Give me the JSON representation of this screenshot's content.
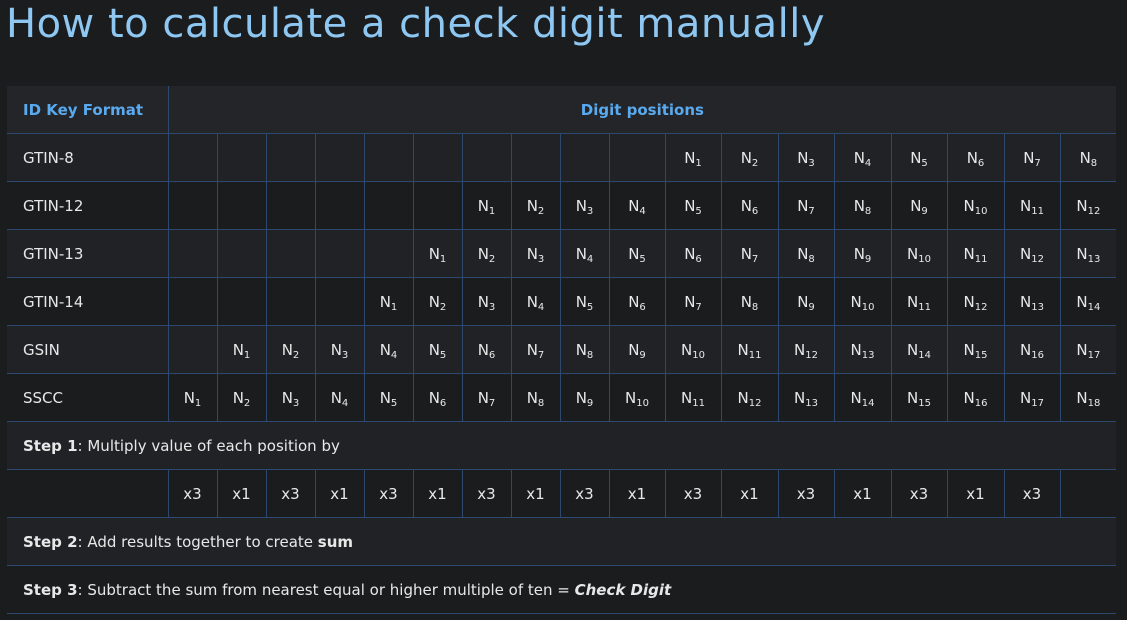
{
  "title": "How to calculate a check digit manually",
  "header": {
    "col0": "ID Key Format",
    "col1": "Digit positions"
  },
  "rows": [
    {
      "label": "GTIN-8",
      "start": 10,
      "count": 8
    },
    {
      "label": "GTIN-12",
      "start": 6,
      "count": 12
    },
    {
      "label": "GTIN-13",
      "start": 5,
      "count": 13
    },
    {
      "label": "GTIN-14",
      "start": 4,
      "count": 14
    },
    {
      "label": "GSIN",
      "start": 1,
      "count": 17
    },
    {
      "label": "SSCC",
      "start": 0,
      "count": 18
    }
  ],
  "digit_prefix": "N",
  "multipliers": [
    "x3",
    "x1",
    "x3",
    "x1",
    "x3",
    "x1",
    "x3",
    "x1",
    "x3",
    "x1",
    "x3",
    "x1",
    "x3",
    "x1",
    "x3",
    "x1",
    "x3",
    ""
  ],
  "step1": {
    "label": "Step 1",
    "text": ": Multiply value of each position by"
  },
  "step2": {
    "label": "Step 2",
    "text": ": Add results together to create ",
    "em": "sum"
  },
  "step3": {
    "label": "Step 3",
    "text": ": Subtract the sum from nearest equal or higher multiple of ten = ",
    "em": "Check Digit"
  }
}
